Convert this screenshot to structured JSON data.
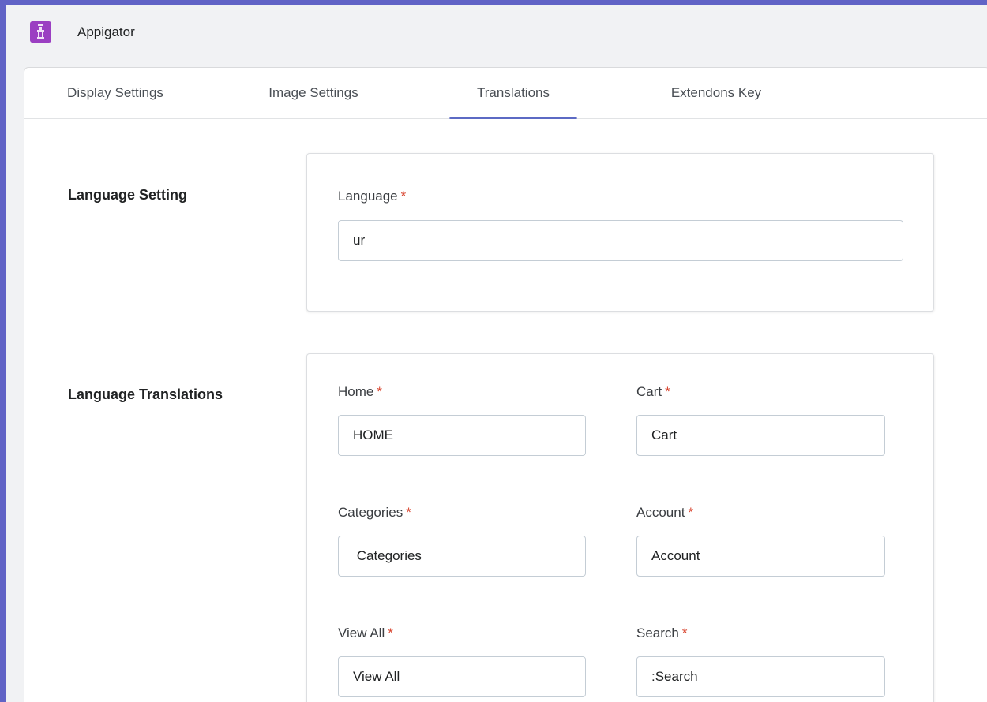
{
  "app": {
    "name": "Appigator",
    "logo_icon": "app-logo-icon",
    "brand_color": "#9b3fc2",
    "frame_color": "#6163c6"
  },
  "tabs": [
    {
      "label": "Display Settings",
      "active": false
    },
    {
      "label": "Image Settings",
      "active": false
    },
    {
      "label": "Translations",
      "active": true
    },
    {
      "label": "Extendons Key",
      "active": false
    }
  ],
  "language_setting": {
    "title": "Language Setting",
    "language": {
      "label": "Language",
      "required": "*",
      "value": "ur"
    }
  },
  "language_translations": {
    "title": "Language Translations",
    "fields": {
      "home": {
        "label": "Home",
        "required": "*",
        "value": "HOME"
      },
      "cart": {
        "label": "Cart",
        "required": "*",
        "value": "Cart"
      },
      "categories": {
        "label": "Categories",
        "required": "*",
        "value": " Categories"
      },
      "account": {
        "label": "Account",
        "required": "*",
        "value": "Account"
      },
      "view_all": {
        "label": "View All",
        "required": "*",
        "value": "View All"
      },
      "search": {
        "label": "Search",
        "required": "*",
        "value": ":Search"
      }
    }
  },
  "colors": {
    "accent": "#5c6ac4",
    "required": "#d8432d"
  }
}
